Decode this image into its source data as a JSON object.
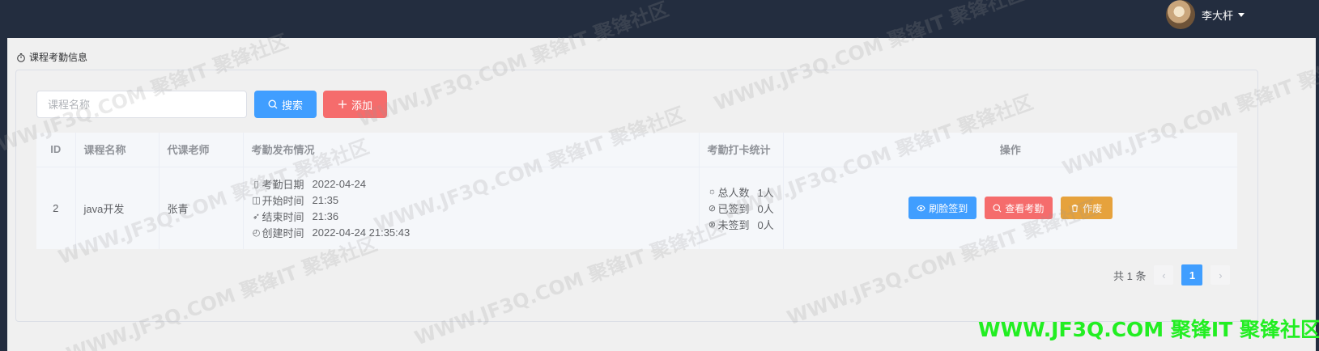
{
  "user": {
    "name": "李大杆"
  },
  "breadcrumb": "课程考勤信息",
  "search": {
    "placeholder": "课程名称",
    "value": ""
  },
  "buttons": {
    "search": "搜索",
    "add": "添加"
  },
  "table": {
    "headers": [
      "ID",
      "课程名称",
      "代课老师",
      "考勤发布情况",
      "考勤打卡统计",
      "操作"
    ],
    "rows": [
      {
        "id": "2",
        "course": "java开发",
        "teacher": "张青",
        "publish": [
          {
            "icon": "calendar-icon",
            "label": "考勤日期",
            "value": "2022-04-24"
          },
          {
            "icon": "clock-icon",
            "label": "开始时间",
            "value": "21:35"
          },
          {
            "icon": "send-icon",
            "label": "结束时间",
            "value": "21:36"
          },
          {
            "icon": "timer-icon",
            "label": "创建时间",
            "value": "2022-04-24 21:35:43"
          }
        ],
        "stats": [
          {
            "icon": "sun-icon",
            "label": "总人数",
            "value": "1人"
          },
          {
            "icon": "check-circle-icon",
            "label": "已签到",
            "value": "0人"
          },
          {
            "icon": "x-circle-icon",
            "label": "未签到",
            "value": "0人"
          }
        ],
        "actions": {
          "face": "刷脸签到",
          "view": "查看考勤",
          "void": "作废"
        }
      }
    ]
  },
  "pagination": {
    "total": "共 1 条",
    "current": "1"
  },
  "watermark": {
    "text": "WWW.JF3Q.COM 聚锋IT 聚锋社区",
    "green": "WWW.JF3Q.COM 聚锋IT 聚锋社区"
  },
  "colors": {
    "topbar": "#232d3f",
    "primary": "#409eff",
    "danger": "#f56c6c",
    "warning": "#e6a23c"
  }
}
